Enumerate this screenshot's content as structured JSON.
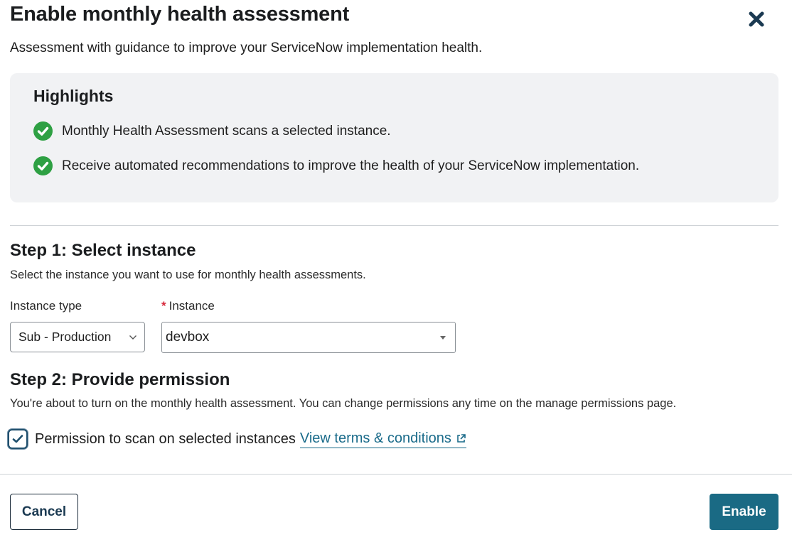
{
  "dialog": {
    "title": "Enable monthly health assessment",
    "subtitle": "Assessment with guidance to improve your ServiceNow implementation health."
  },
  "highlights": {
    "title": "Highlights",
    "items": [
      {
        "icon": "check-circle-icon",
        "text": "Monthly Health Assessment scans a selected instance."
      },
      {
        "icon": "check-circle-icon",
        "text": "Receive automated recommendations to improve the health of your ServiceNow implementation."
      }
    ]
  },
  "step1": {
    "title": "Step 1: Select instance",
    "description": "Select the instance you want to use for monthly health assessments.",
    "instance_type_label": "Instance type",
    "instance_type_value": "Sub - Production",
    "instance_label": "Instance",
    "instance_required": "*",
    "instance_value": "devbox"
  },
  "step2": {
    "title": "Step 2: Provide permission",
    "description": "You're about to turn on the monthly health assessment. You can change permissions any time on the manage permissions page.",
    "permission_label": "Permission to scan on selected instances",
    "permission_checked": true,
    "terms_link": "View terms & conditions"
  },
  "footer": {
    "cancel_label": "Cancel",
    "enable_label": "Enable"
  },
  "colors": {
    "success_green": "#2ea043",
    "primary_teal": "#1a6a84",
    "link_teal": "#1a6b8a",
    "required_red": "#d6283a",
    "panel_gray": "#f1f2f4"
  }
}
